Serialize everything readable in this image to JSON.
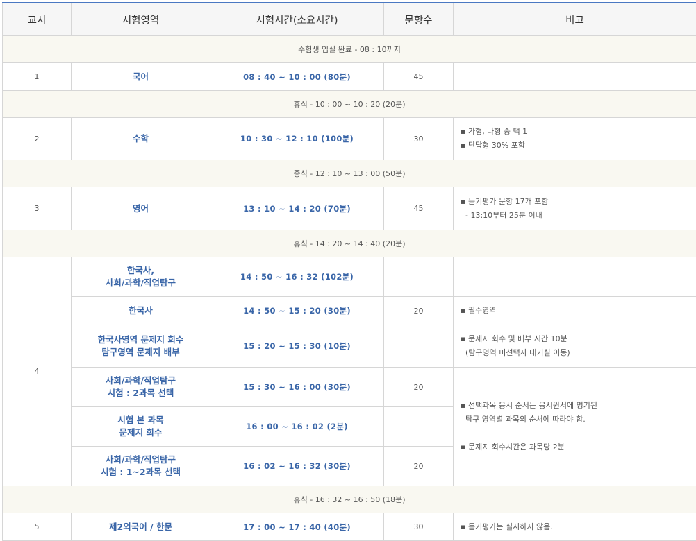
{
  "headers": [
    "교시",
    "시험영역",
    "시험시간(소요시간)",
    "문항수",
    "비고"
  ],
  "sep_entry": "수험생 입실 완료 - 08 : 10까지",
  "rows": {
    "p1": {
      "period": "1",
      "subject": "국어",
      "time": "08 : 40 ~ 10 : 00 (80분)",
      "count": "45",
      "note": []
    },
    "sep1": "휴식 - 10 : 00 ~ 10 : 20 (20분)",
    "p2": {
      "period": "2",
      "subject": "수학",
      "time": "10 : 30 ~ 12 : 10 (100분)",
      "count": "30",
      "note": [
        "▪ 가형, 나형 중 택 1",
        "▪ 단답형 30% 포함"
      ]
    },
    "sep2": "중식 - 12 : 10 ~ 13 : 00 (50분)",
    "p3": {
      "period": "3",
      "subject": "영어",
      "time": "13 : 10 ~ 14 : 20 (70분)",
      "count": "45",
      "note": [
        "▪ 듣기평가 문항 17개 포함",
        "  - 13:10부터 25분 이내"
      ]
    },
    "sep3": "휴식 - 14 : 20 ~ 14 : 40 (20분)",
    "p4": {
      "period": "4",
      "sub": [
        {
          "subject": [
            "한국사,",
            "사회/과학/직업탐구"
          ],
          "time": "14 : 50 ~ 16 : 32 (102분)",
          "count": ""
        },
        {
          "subject": [
            "한국사"
          ],
          "time": "14 : 50 ~ 15 : 20 (30분)",
          "count": "20"
        },
        {
          "subject": [
            "한국사영역 문제지 회수",
            "탐구영역 문제지 배부"
          ],
          "time": "15 : 20 ~ 15 : 30 (10분)",
          "count": ""
        },
        {
          "subject": [
            "사회/과학/직업탐구",
            "시험 : 2과목 선택"
          ],
          "time": "15 : 30 ~ 16 : 00 (30분)",
          "count": "20"
        },
        {
          "subject": [
            "시험 본 과목",
            "문제지 회수"
          ],
          "time": "16 : 00 ~ 16 : 02 (2분)",
          "count": ""
        },
        {
          "subject": [
            "사회/과학/직업탐구",
            "시험 : 1~2과목 선택"
          ],
          "time": "16 : 02 ~ 16 : 32 (30분)",
          "count": "20"
        }
      ],
      "notes": {
        "korean_history": "▪ 필수영역",
        "collect": [
          "▪ 문제지 회수 및 배부 시간 10분",
          "  (탐구영역 미선택자 대기실 이동)"
        ],
        "select": [
          "▪ 선택과목 응시 순서는 응시원서에 명기된",
          "  탐구 영역별 과목의 순서에 따라야 함.",
          "▪ 문제지 회수시간은 과목당 2분"
        ]
      }
    },
    "sep4": "휴식 - 16 : 32 ~ 16 : 50 (18분)",
    "p5": {
      "period": "5",
      "subject": "제2외국어 / 한문",
      "time": "17 : 00 ~ 17 : 40 (40분)",
      "count": "30",
      "note": [
        "▪ 듣기평가는 실시하지 않음."
      ]
    }
  }
}
